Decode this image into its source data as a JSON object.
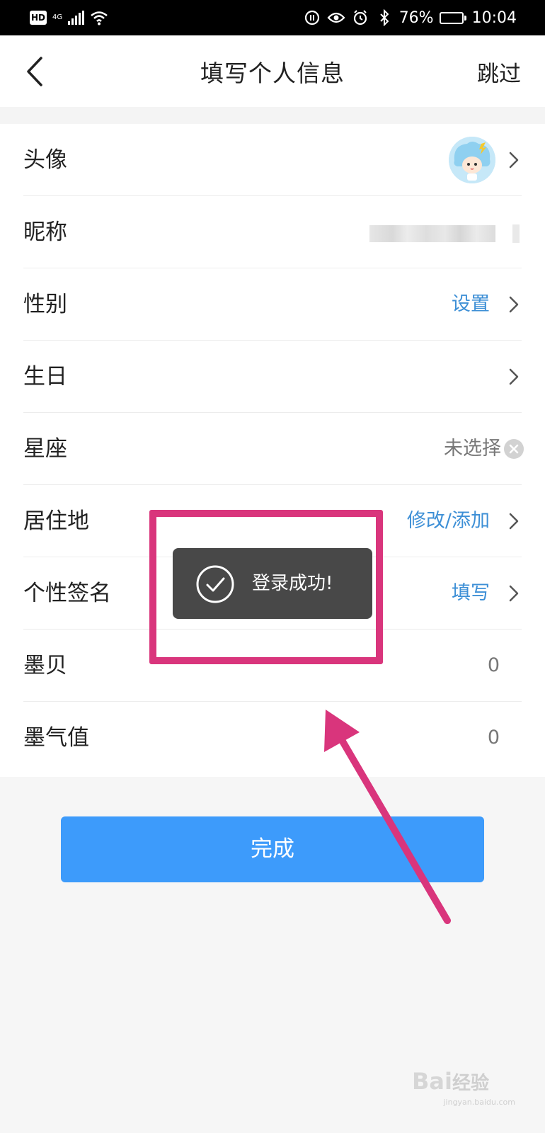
{
  "status_bar": {
    "hd": "HD",
    "network": "4G",
    "battery_percent": "76%",
    "time": "10:04",
    "battery_level": 0.76
  },
  "header": {
    "title": "填写个人信息",
    "skip_label": "跳过"
  },
  "rows": [
    {
      "label": "头像",
      "value": "",
      "value_kind": "avatar",
      "arrow": true
    },
    {
      "label": "昵称",
      "value": "",
      "value_kind": "blurred",
      "arrow": false
    },
    {
      "label": "性别",
      "value": "设置",
      "value_kind": "link",
      "arrow": true
    },
    {
      "label": "生日",
      "value": "",
      "value_kind": "empty",
      "arrow": true
    },
    {
      "label": "星座",
      "value": "未选择",
      "value_kind": "clearable",
      "arrow": false
    },
    {
      "label": "居住地",
      "value": "修改/添加",
      "value_kind": "link",
      "arrow": true
    },
    {
      "label": "个性签名",
      "value": "填写",
      "value_kind": "link",
      "arrow": true
    },
    {
      "label": "墨贝",
      "value": "0",
      "value_kind": "number",
      "arrow": false
    },
    {
      "label": "墨气值",
      "value": "0",
      "value_kind": "number",
      "arrow": false
    }
  ],
  "done_button": {
    "label": "完成"
  },
  "toast": {
    "text": "登录成功!"
  },
  "watermark": {
    "brand": "Bai",
    "brand_cn": "经验",
    "url": "jingyan.baidu.com"
  },
  "icons": {
    "back": "chevron-left-icon",
    "row_arrow": "chevron-right-icon",
    "clear": "clear-circle-icon",
    "toast": "check-circle-icon"
  },
  "colors": {
    "link": "#3d8fd6",
    "primary_button": "#3d9bfb",
    "annotation": "#d9357c",
    "toast_bg": "#3e3e3e"
  }
}
